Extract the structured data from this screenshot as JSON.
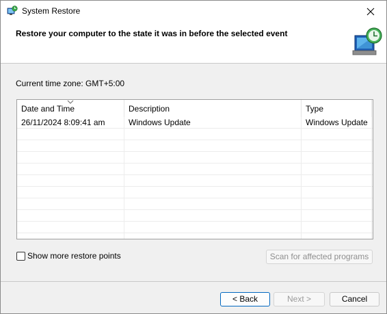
{
  "window": {
    "title": "System Restore"
  },
  "header": {
    "title": "Restore your computer to the state it was in before the selected event"
  },
  "timezone_label": "Current time zone: GMT+5:00",
  "table": {
    "columns": [
      "Date and Time",
      "Description",
      "Type"
    ],
    "rows": [
      [
        "26/11/2024 8:09:41 am",
        "Windows Update",
        "Windows Update"
      ]
    ]
  },
  "checkbox": {
    "label": "Show more restore points",
    "checked": false
  },
  "buttons": {
    "scan": "Scan for affected programs",
    "back": "< Back",
    "next": "Next >",
    "cancel": "Cancel"
  },
  "colors": {
    "accent": "#0067c0",
    "window_bg": "#f0f0f0"
  }
}
